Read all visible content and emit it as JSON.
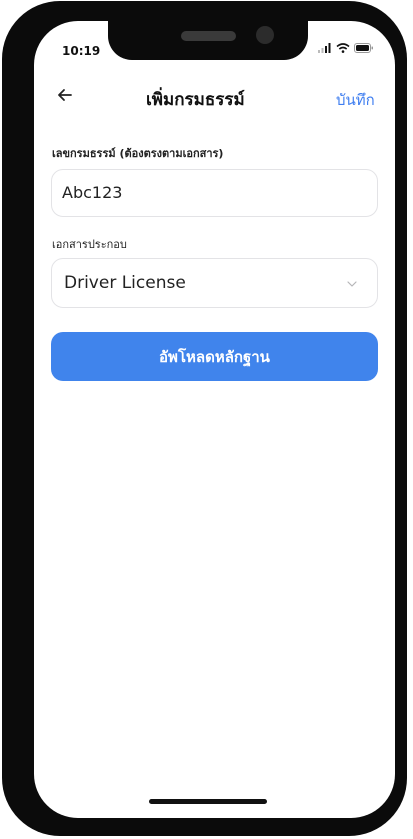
{
  "status_bar": {
    "time": "10:19"
  },
  "nav": {
    "title": "เพิ่มกรมธรรม์",
    "save_label": "บันทึก",
    "back_icon": "arrow-left-icon"
  },
  "form": {
    "policy_number": {
      "label": "เลขกรมธรรม์ (ต้องตรงตามเอกสาร)",
      "value": "Abc123"
    },
    "document_type": {
      "label": "เอกสารประกอบ",
      "selected": "Driver License"
    },
    "upload_button": {
      "label": "อัพโหลดหลักฐาน"
    }
  },
  "colors": {
    "accent": "#4084ec",
    "link": "#3f7ef0"
  }
}
